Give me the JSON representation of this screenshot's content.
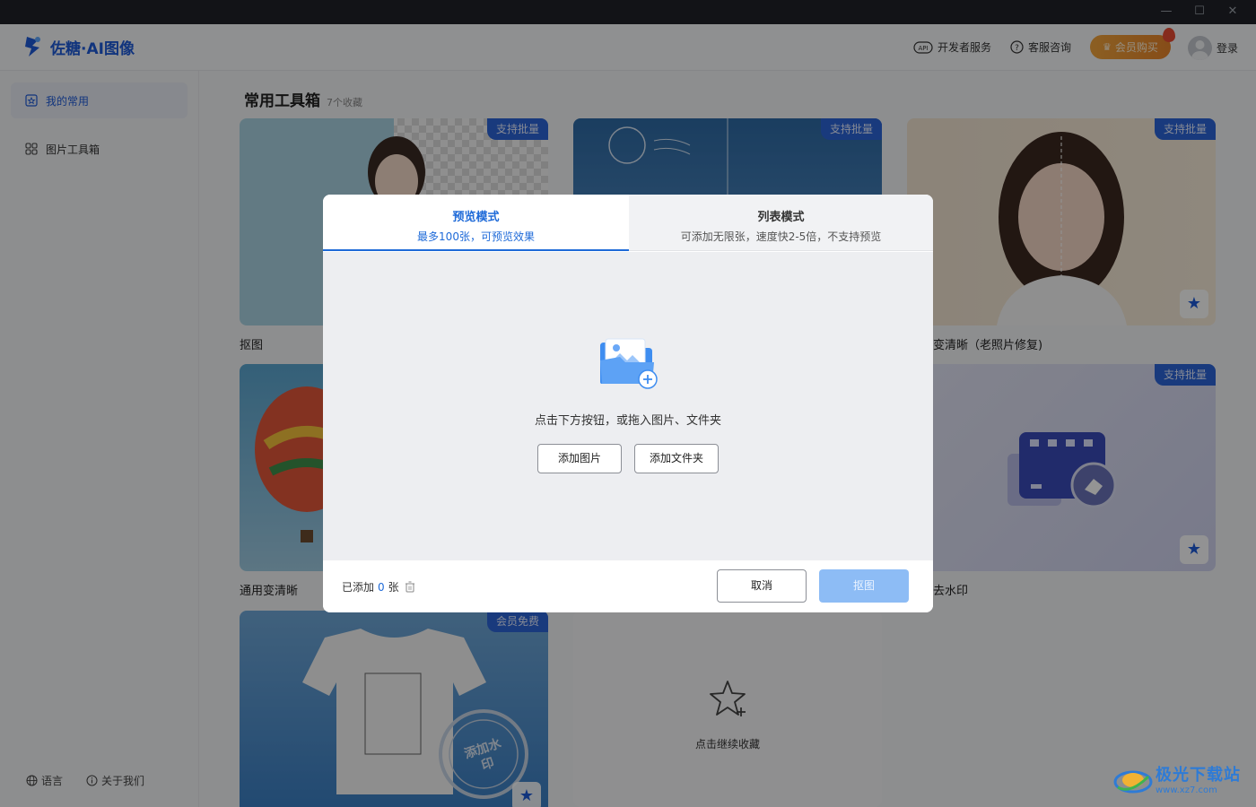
{
  "app": {
    "name": "佐糖·AI图像",
    "window_controls": {
      "minimize": "—",
      "maximize": "☐",
      "close": "✕"
    }
  },
  "header": {
    "developer": "开发者服务",
    "support": "客服咨询",
    "vip": "会员购买",
    "login": "登录"
  },
  "sidebar": {
    "items": [
      {
        "label": "我的常用",
        "icon": "favorites-icon",
        "active": true
      },
      {
        "label": "图片工具箱",
        "icon": "grid-icon",
        "active": false
      }
    ],
    "footer": {
      "language": "语言",
      "about": "关于我们"
    }
  },
  "main": {
    "title": "常用工具箱",
    "count": "7个收藏",
    "cards": [
      {
        "label": "抠图",
        "badge": "支持批量"
      },
      {
        "label": "",
        "badge": "支持批量"
      },
      {
        "label": "变清晰（老照片修复)",
        "badge": "支持批量"
      },
      {
        "label": "通用变清晰",
        "badge": ""
      },
      {
        "label": "去水印",
        "badge": "支持批量"
      },
      {
        "label": "",
        "badge": "会员免费"
      }
    ],
    "add_more": "点击继续收藏",
    "stamp_text": "添加水印"
  },
  "modal": {
    "tabs": [
      {
        "title": "预览模式",
        "subtitle": "最多100张，可预览效果"
      },
      {
        "title": "列表模式",
        "subtitle": "可添加无限张，速度快2-5倍，不支持预览"
      }
    ],
    "drop_hint": "点击下方按钮，或拖入图片、文件夹",
    "add_images": "添加图片",
    "add_folder": "添加文件夹",
    "added_prefix": "已添加",
    "added_count": "0",
    "added_unit": "张",
    "cancel": "取消",
    "confirm": "抠图"
  },
  "watermark": {
    "title": "极光下载站",
    "url": "www.xz7.com"
  },
  "colors": {
    "accent": "#1e6ad8",
    "badge": "#2b64d8",
    "vip": "#e7842a"
  }
}
